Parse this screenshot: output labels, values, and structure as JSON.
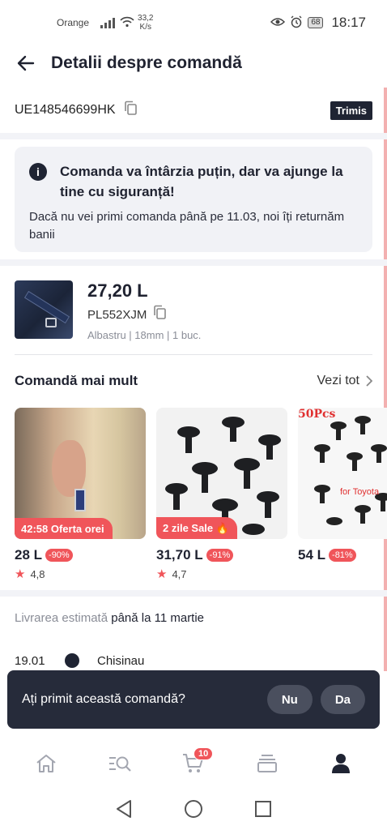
{
  "status_bar": {
    "carrier": "Orange",
    "speed_value": "33,2",
    "speed_unit": "K/s",
    "battery": "68",
    "time": "18:17"
  },
  "header": {
    "title": "Detalii despre comandă"
  },
  "order": {
    "id": "UE148546699HK",
    "status": "Trimis"
  },
  "notice": {
    "title": "Comanda va întârzia puțin, dar va ajunge la tine cu siguranță!",
    "body": "Dacă nu vei primi comanda până pe 11.03, noi îți returnăm banii"
  },
  "product": {
    "price": "27,20 L",
    "sku": "PL552XJM",
    "variant": "Albastru | 18mm | 1 buc."
  },
  "more": {
    "title": "Comandă mai mult",
    "see_all": "Vezi tot",
    "items": [
      {
        "promo": "42:58 Oferta orei",
        "price": "28 L",
        "discount": "-90%",
        "rating": "4,8"
      },
      {
        "promo": "2 zile Sale 🔥",
        "price": "31,70 L",
        "discount": "-91%",
        "rating": "4,7"
      },
      {
        "price": "54 L",
        "discount": "-81%",
        "image_text_top": "50Pcs",
        "image_text_brand": "for Toyota"
      }
    ]
  },
  "delivery": {
    "label": "Livrarea estimată",
    "value": "până la 11 martie"
  },
  "timeline": {
    "date": "19.01",
    "city": "Chisinau"
  },
  "prompt": {
    "question": "Ați primit această comandă?",
    "no": "Nu",
    "yes": "Da"
  },
  "bottom_nav": {
    "cart_count": "10",
    "icons": [
      "home-icon",
      "search-icon",
      "cart-icon",
      "orders-icon",
      "account-icon"
    ]
  },
  "colors": {
    "accent": "#f0555a",
    "dark": "#1f2433",
    "notice_bg": "#f1f2f6",
    "prompt_bg": "#262b3a"
  }
}
